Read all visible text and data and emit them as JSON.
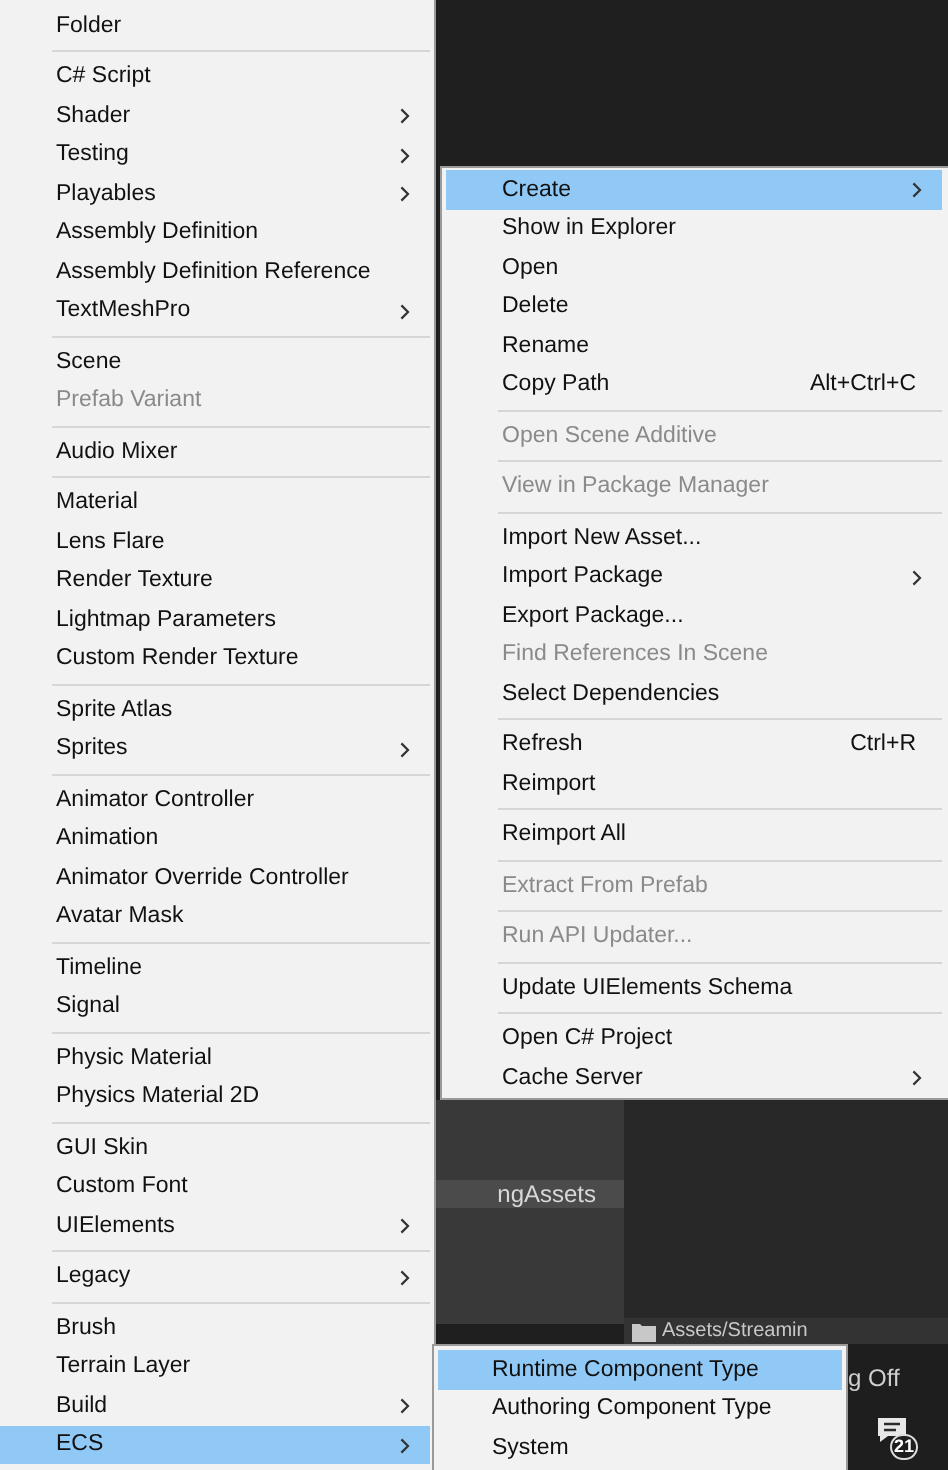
{
  "create_menu": {
    "groups": [
      [
        {
          "label": "Folder",
          "submenu": false,
          "disabled": false,
          "selected": false
        }
      ],
      [
        {
          "label": "C# Script",
          "submenu": false,
          "disabled": false,
          "selected": false
        },
        {
          "label": "Shader",
          "submenu": true,
          "disabled": false,
          "selected": false
        },
        {
          "label": "Testing",
          "submenu": true,
          "disabled": false,
          "selected": false
        },
        {
          "label": "Playables",
          "submenu": true,
          "disabled": false,
          "selected": false
        },
        {
          "label": "Assembly Definition",
          "submenu": false,
          "disabled": false,
          "selected": false
        },
        {
          "label": "Assembly Definition Reference",
          "submenu": false,
          "disabled": false,
          "selected": false
        },
        {
          "label": "TextMeshPro",
          "submenu": true,
          "disabled": false,
          "selected": false
        }
      ],
      [
        {
          "label": "Scene",
          "submenu": false,
          "disabled": false,
          "selected": false
        },
        {
          "label": "Prefab Variant",
          "submenu": false,
          "disabled": true,
          "selected": false
        }
      ],
      [
        {
          "label": "Audio Mixer",
          "submenu": false,
          "disabled": false,
          "selected": false
        }
      ],
      [
        {
          "label": "Material",
          "submenu": false,
          "disabled": false,
          "selected": false
        },
        {
          "label": "Lens Flare",
          "submenu": false,
          "disabled": false,
          "selected": false
        },
        {
          "label": "Render Texture",
          "submenu": false,
          "disabled": false,
          "selected": false
        },
        {
          "label": "Lightmap Parameters",
          "submenu": false,
          "disabled": false,
          "selected": false
        },
        {
          "label": "Custom Render Texture",
          "submenu": false,
          "disabled": false,
          "selected": false
        }
      ],
      [
        {
          "label": "Sprite Atlas",
          "submenu": false,
          "disabled": false,
          "selected": false
        },
        {
          "label": "Sprites",
          "submenu": true,
          "disabled": false,
          "selected": false
        }
      ],
      [
        {
          "label": "Animator Controller",
          "submenu": false,
          "disabled": false,
          "selected": false
        },
        {
          "label": "Animation",
          "submenu": false,
          "disabled": false,
          "selected": false
        },
        {
          "label": "Animator Override Controller",
          "submenu": false,
          "disabled": false,
          "selected": false
        },
        {
          "label": "Avatar Mask",
          "submenu": false,
          "disabled": false,
          "selected": false
        }
      ],
      [
        {
          "label": "Timeline",
          "submenu": false,
          "disabled": false,
          "selected": false
        },
        {
          "label": "Signal",
          "submenu": false,
          "disabled": false,
          "selected": false
        }
      ],
      [
        {
          "label": "Physic Material",
          "submenu": false,
          "disabled": false,
          "selected": false
        },
        {
          "label": "Physics Material 2D",
          "submenu": false,
          "disabled": false,
          "selected": false
        }
      ],
      [
        {
          "label": "GUI Skin",
          "submenu": false,
          "disabled": false,
          "selected": false
        },
        {
          "label": "Custom Font",
          "submenu": false,
          "disabled": false,
          "selected": false
        },
        {
          "label": "UIElements",
          "submenu": true,
          "disabled": false,
          "selected": false
        }
      ],
      [
        {
          "label": "Legacy",
          "submenu": true,
          "disabled": false,
          "selected": false
        }
      ],
      [
        {
          "label": "Brush",
          "submenu": false,
          "disabled": false,
          "selected": false
        },
        {
          "label": "Terrain Layer",
          "submenu": false,
          "disabled": false,
          "selected": false
        },
        {
          "label": "Build",
          "submenu": true,
          "disabled": false,
          "selected": false
        },
        {
          "label": "ECS",
          "submenu": true,
          "disabled": false,
          "selected": true
        }
      ]
    ]
  },
  "asset_menu": {
    "groups": [
      [
        {
          "label": "Create",
          "submenu": true,
          "disabled": false,
          "selected": true
        },
        {
          "label": "Show in Explorer",
          "submenu": false,
          "disabled": false,
          "selected": false
        },
        {
          "label": "Open",
          "submenu": false,
          "disabled": false,
          "selected": false
        },
        {
          "label": "Delete",
          "submenu": false,
          "disabled": false,
          "selected": false
        },
        {
          "label": "Rename",
          "submenu": false,
          "disabled": false,
          "selected": false
        },
        {
          "label": "Copy Path",
          "shortcut": "Alt+Ctrl+C",
          "submenu": false,
          "disabled": false,
          "selected": false
        }
      ],
      [
        {
          "label": "Open Scene Additive",
          "submenu": false,
          "disabled": true,
          "selected": false
        }
      ],
      [
        {
          "label": "View in Package Manager",
          "submenu": false,
          "disabled": true,
          "selected": false
        }
      ],
      [
        {
          "label": "Import New Asset...",
          "submenu": false,
          "disabled": false,
          "selected": false
        },
        {
          "label": "Import Package",
          "submenu": true,
          "disabled": false,
          "selected": false
        },
        {
          "label": "Export Package...",
          "submenu": false,
          "disabled": false,
          "selected": false
        },
        {
          "label": "Find References In Scene",
          "submenu": false,
          "disabled": true,
          "selected": false
        },
        {
          "label": "Select Dependencies",
          "submenu": false,
          "disabled": false,
          "selected": false
        }
      ],
      [
        {
          "label": "Refresh",
          "shortcut": "Ctrl+R",
          "submenu": false,
          "disabled": false,
          "selected": false
        },
        {
          "label": "Reimport",
          "submenu": false,
          "disabled": false,
          "selected": false
        }
      ],
      [
        {
          "label": "Reimport All",
          "submenu": false,
          "disabled": false,
          "selected": false
        }
      ],
      [
        {
          "label": "Extract From Prefab",
          "submenu": false,
          "disabled": true,
          "selected": false
        }
      ],
      [
        {
          "label": "Run API Updater...",
          "submenu": false,
          "disabled": true,
          "selected": false
        }
      ],
      [
        {
          "label": "Update UIElements Schema",
          "submenu": false,
          "disabled": false,
          "selected": false
        }
      ],
      [
        {
          "label": "Open C# Project",
          "submenu": false,
          "disabled": false,
          "selected": false
        },
        {
          "label": "Cache Server",
          "submenu": true,
          "disabled": false,
          "selected": false
        }
      ]
    ]
  },
  "ecs_submenu": {
    "items": [
      {
        "label": "Runtime Component Type",
        "selected": true
      },
      {
        "label": "Authoring Component Type",
        "selected": false
      },
      {
        "label": "System",
        "selected": false
      }
    ]
  },
  "background": {
    "folder_label": "ngAssets",
    "path_label": "Assets/Streamin",
    "status_text": "g Off",
    "notification_count": "21"
  }
}
